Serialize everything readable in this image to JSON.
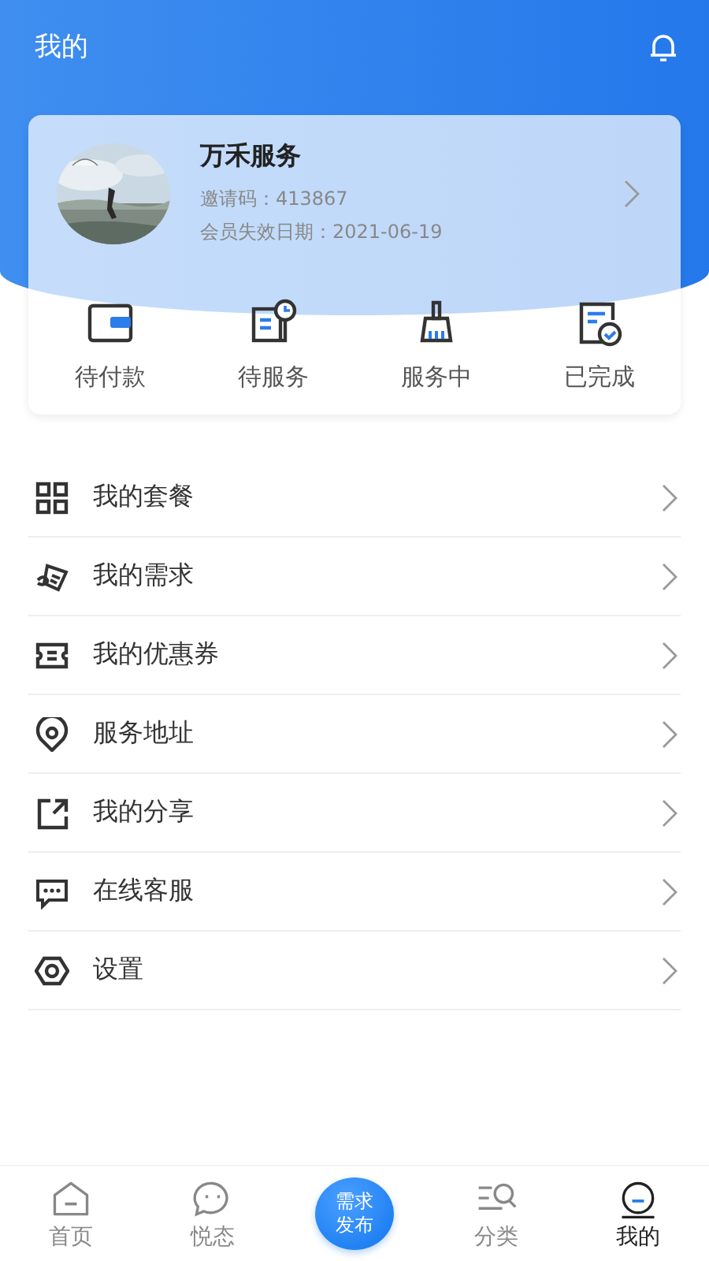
{
  "header": {
    "title": "我的"
  },
  "profile": {
    "name": "万禾服务",
    "invite_code": "邀请码：413867",
    "expiry": "会员失效日期：2021-06-19"
  },
  "orders": [
    {
      "label": "待付款"
    },
    {
      "label": "待服务"
    },
    {
      "label": "服务中"
    },
    {
      "label": "已完成"
    }
  ],
  "menu": [
    {
      "label": "我的套餐"
    },
    {
      "label": "我的需求"
    },
    {
      "label": "我的优惠券"
    },
    {
      "label": "服务地址"
    },
    {
      "label": "我的分享"
    },
    {
      "label": "在线客服"
    },
    {
      "label": "设置"
    }
  ],
  "bottom_nav": [
    {
      "kind": "tab",
      "label": "首页",
      "selected": false
    },
    {
      "kind": "tab",
      "label": "悦态",
      "selected": false
    },
    {
      "kind": "publish",
      "label": "需求发布"
    },
    {
      "kind": "tab",
      "label": "分类",
      "selected": false
    },
    {
      "kind": "tab",
      "label": "我的",
      "selected": true
    }
  ]
}
